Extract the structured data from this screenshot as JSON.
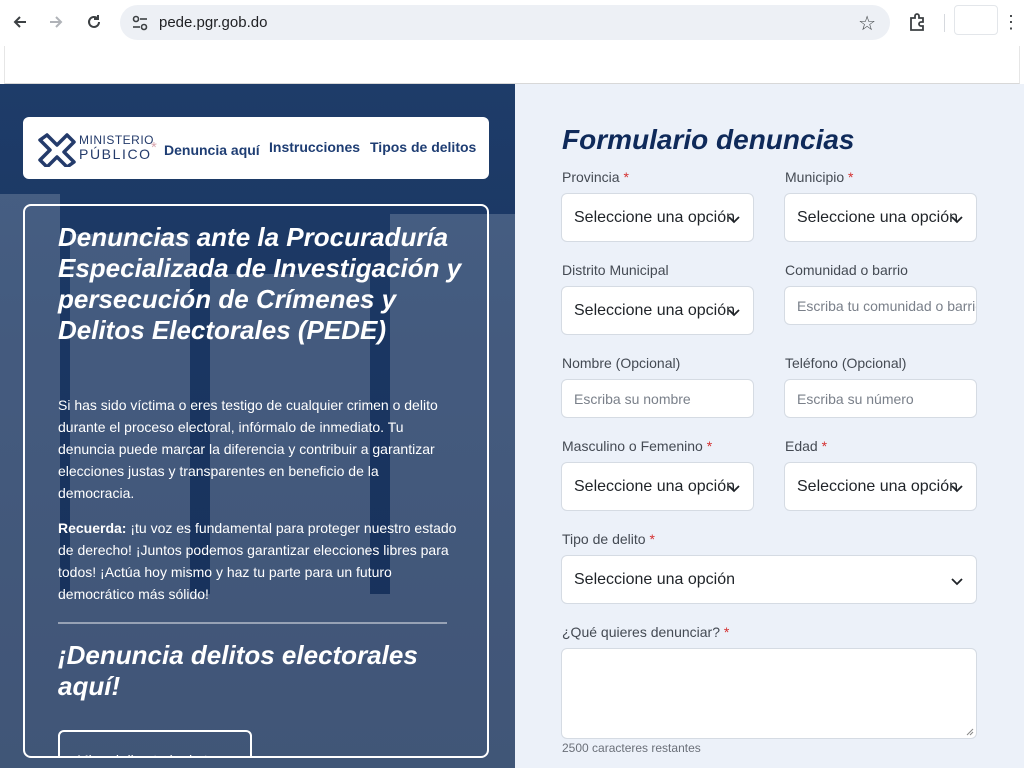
{
  "browser": {
    "url": "pede.pgr.gob.do"
  },
  "nav": {
    "logo_line1": "MINISTERIO",
    "logo_line2": "PÚBLICO",
    "links": [
      "Denuncia aquí",
      "Instrucciones",
      "Tipos de delitos"
    ]
  },
  "hero": {
    "title": "Denuncias ante la Procuraduría Especializada de Investigación y persecución de Crímenes y Delitos Electorales (PEDE)",
    "paragraph1": "Si has sido víctima o eres testigo de cualquier crimen o delito durante el proceso electoral, infórmalo de inmediato. Tu denuncia puede marcar la diferencia y contribuir a garantizar elecciones justas y transparentes en beneficio de la democracia.",
    "remember_label": "Recuerda:",
    "paragraph2": " ¡tu voz es fundamental para proteger nuestro estado de derecho! ¡Juntos podemos garantizar elecciones libres para todos! ¡Actúa hoy mismo y haz tu parte para un futuro democrático más sólido!",
    "cta_title": "¡Denuncia delitos electorales aquí!",
    "directory_button": "Mira el directorio de tu"
  },
  "form": {
    "title": "Formulario denuncias",
    "required_mark": "*",
    "provincia": {
      "label": "Provincia",
      "value": "Seleccione una opción"
    },
    "municipio": {
      "label": "Municipio",
      "value": "Seleccione una opción"
    },
    "distrito": {
      "label": "Distrito Municipal",
      "value": "Seleccione una opción"
    },
    "comunidad": {
      "label": "Comunidad o barrio",
      "placeholder": "Escriba tu comunidad o barrio"
    },
    "nombre": {
      "label": "Nombre (Opcional)",
      "placeholder": "Escriba su nombre"
    },
    "telefono": {
      "label": "Teléfono (Opcional)",
      "placeholder": "Escriba su número"
    },
    "genero": {
      "label": "Masculino o Femenino",
      "value": "Seleccione una opción"
    },
    "edad": {
      "label": "Edad",
      "value": "Seleccione una opción"
    },
    "tipo_delito": {
      "label": "Tipo de delito",
      "value": "Seleccione una opción"
    },
    "denuncia": {
      "label": "¿Qué quieres denunciar?",
      "value": ""
    },
    "chars_remaining": "2500 caracteres restantes"
  },
  "colors": {
    "brand_navy": "#1d3a68",
    "form_bg": "#ecf1f9",
    "required": "#d43030"
  }
}
